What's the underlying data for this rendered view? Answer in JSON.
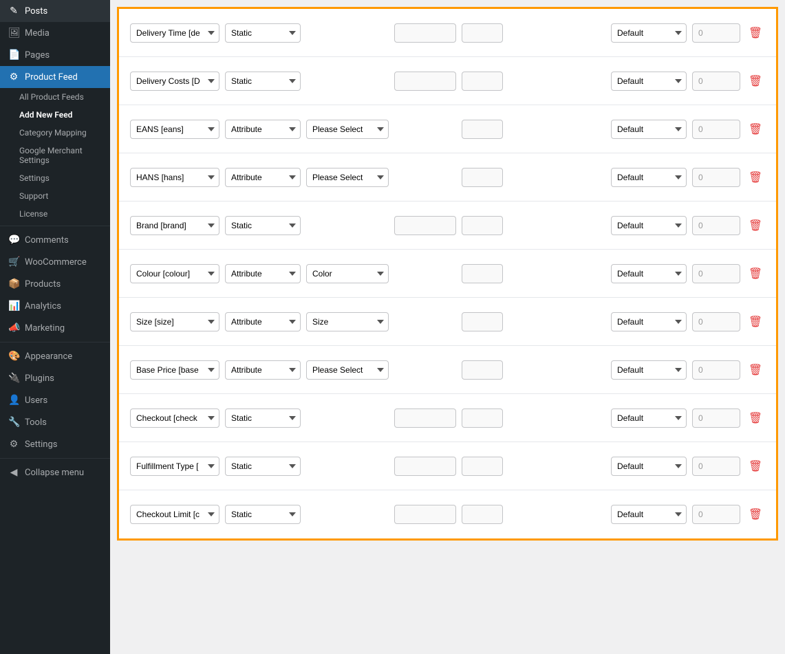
{
  "sidebar": {
    "items": [
      {
        "label": "Posts",
        "icon": "✎",
        "active": false
      },
      {
        "label": "Media",
        "icon": "🖼",
        "active": false
      },
      {
        "label": "Pages",
        "icon": "📄",
        "active": false
      },
      {
        "label": "Product Feed",
        "icon": "⚙",
        "active": true
      }
    ],
    "submenu": [
      {
        "label": "All Product Feeds",
        "active": false
      },
      {
        "label": "Add New Feed",
        "active": true
      },
      {
        "label": "Category Mapping",
        "active": false
      },
      {
        "label": "Google Merchant Settings",
        "active": false
      },
      {
        "label": "Settings",
        "active": false
      },
      {
        "label": "Support",
        "active": false
      },
      {
        "label": "License",
        "active": false
      }
    ],
    "bottomItems": [
      {
        "label": "Comments",
        "icon": "💬",
        "active": false
      },
      {
        "label": "WooCommerce",
        "icon": "🛒",
        "active": false
      },
      {
        "label": "Products",
        "icon": "📦",
        "active": false
      },
      {
        "label": "Analytics",
        "icon": "📊",
        "active": false
      },
      {
        "label": "Marketing",
        "icon": "📣",
        "active": false
      },
      {
        "label": "Appearance",
        "icon": "🎨",
        "active": false
      },
      {
        "label": "Plugins",
        "icon": "🔌",
        "active": false
      },
      {
        "label": "Users",
        "icon": "👤",
        "active": false
      },
      {
        "label": "Tools",
        "icon": "🔧",
        "active": false
      },
      {
        "label": "Settings",
        "icon": "⚙",
        "active": false
      },
      {
        "label": "Collapse menu",
        "icon": "◀",
        "active": false
      }
    ]
  },
  "rows": [
    {
      "id": "row-1",
      "field": "Delivery Time [de",
      "type": "Static",
      "attr": "",
      "attrHidden": true,
      "textValue": "",
      "prependValue": "",
      "default": "Default",
      "priority": "0"
    },
    {
      "id": "row-2",
      "field": "Delivery Costs [D",
      "type": "Static",
      "attr": "",
      "attrHidden": true,
      "textValue": "",
      "prependValue": "",
      "default": "Default",
      "priority": "0"
    },
    {
      "id": "row-3",
      "field": "EANS [eans]",
      "type": "Attribute",
      "attr": "Please Select",
      "attrHidden": false,
      "textValue": "",
      "prependValue": "",
      "default": "Default",
      "priority": "0"
    },
    {
      "id": "row-4",
      "field": "HANS [hans]",
      "type": "Attribute",
      "attr": "Please Select",
      "attrHidden": false,
      "textValue": "",
      "prependValue": "",
      "default": "Default",
      "priority": "0"
    },
    {
      "id": "row-5",
      "field": "Brand [brand]",
      "type": "Static",
      "attr": "",
      "attrHidden": true,
      "textValue": "",
      "prependValue": "",
      "default": "Default",
      "priority": "0"
    },
    {
      "id": "row-6",
      "field": "Colour [colour]",
      "type": "Attribute",
      "attr": "Color",
      "attrHidden": false,
      "textValue": "",
      "prependValue": "",
      "default": "Default",
      "priority": "0"
    },
    {
      "id": "row-7",
      "field": "Size [size]",
      "type": "Attribute",
      "attr": "Size",
      "attrHidden": false,
      "textValue": "",
      "prependValue": "",
      "default": "Default",
      "priority": "0"
    },
    {
      "id": "row-8",
      "field": "Base Price [base",
      "type": "Attribute",
      "attr": "Please Select",
      "attrHidden": false,
      "textValue": "",
      "prependValue": "",
      "default": "Default",
      "priority": "0"
    },
    {
      "id": "row-9",
      "field": "Checkout [check",
      "type": "Static",
      "attr": "",
      "attrHidden": true,
      "textValue": "",
      "prependValue": "",
      "default": "Default",
      "priority": "0"
    },
    {
      "id": "row-10",
      "field": "Fulfillment Type [",
      "type": "Static",
      "attr": "",
      "attrHidden": true,
      "textValue": "",
      "prependValue": "",
      "default": "Default",
      "priority": "0"
    },
    {
      "id": "row-11",
      "field": "Checkout Limit [c",
      "type": "Static",
      "attr": "",
      "attrHidden": true,
      "textValue": "",
      "prependValue": "",
      "default": "Default",
      "priority": "0"
    }
  ],
  "labels": {
    "delete_icon": "🗑",
    "default_option": "Default",
    "static_option": "Static",
    "attribute_option": "Attribute",
    "please_select": "Please Select",
    "color_option": "Color",
    "size_option": "Size",
    "collapse": "Collapse menu"
  }
}
